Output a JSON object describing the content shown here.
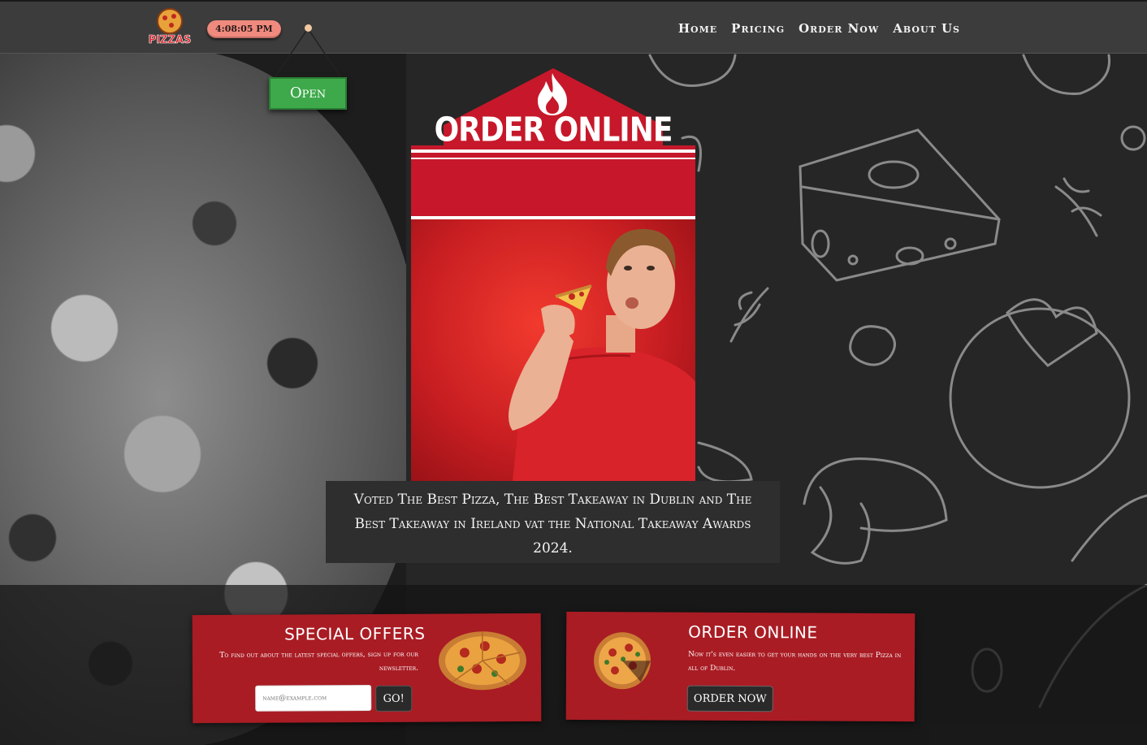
{
  "header": {
    "logo_text": "PIZZAS",
    "clock": "4:08:05 PM",
    "nav": [
      {
        "label": "Home"
      },
      {
        "label": "Pricing"
      },
      {
        "label": "Order Now"
      },
      {
        "label": "About Us"
      }
    ]
  },
  "sign": {
    "label": "Open",
    "color": "#3da94a"
  },
  "hero": {
    "title": "ORDER ONLINE",
    "caption": "Voted The Best Pizza, The Best Takeaway in Dublin and The Best Takeaway in Ireland vat the National Takeaway Awards 2024."
  },
  "offers": {
    "title": "SPECIAL OFFERS",
    "text": "To find out about the latest special offers, sign up for our newsletter.",
    "email_placeholder": "name@example.com",
    "go_label": "GO!"
  },
  "order": {
    "title": "ORDER ONLINE",
    "text": "Now it's even easier to get your hands on the very best Pizza in all of Dublin.",
    "button_label": "ORDER NOW"
  },
  "colors": {
    "brand_red": "#c6182a",
    "card_red": "#a91c24",
    "header": "#3c3c3c",
    "clock_pill": "#f08a7e"
  }
}
